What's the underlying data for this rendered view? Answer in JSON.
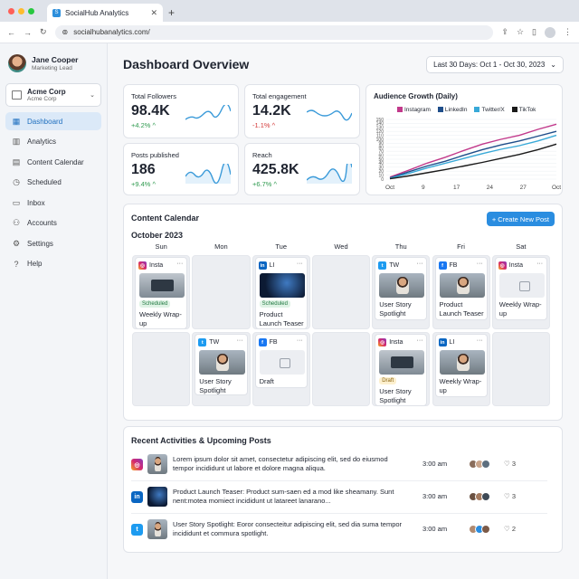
{
  "browser": {
    "tab_title": "SocialHub Analytics",
    "tab_close": "✕",
    "new_tab": "+",
    "url": "socialhubanalytics.com/",
    "traffic_colors": [
      "#ff5f57",
      "#febc2e",
      "#28c840"
    ]
  },
  "user": {
    "name": "Jane Cooper",
    "role": "Marketing Lead"
  },
  "org": {
    "name": "Acme Corp",
    "sub": "Acme Corp"
  },
  "nav": [
    {
      "label": "Dashboard",
      "icon": "grid-icon",
      "glyph": "▦",
      "active": true
    },
    {
      "label": "Analytics",
      "icon": "bar-chart-icon",
      "glyph": "▥"
    },
    {
      "label": "Content Calendar",
      "icon": "calendar-icon",
      "glyph": "▤"
    },
    {
      "label": "Scheduled",
      "icon": "clock-icon",
      "glyph": "◷"
    },
    {
      "label": "Inbox",
      "icon": "inbox-icon",
      "glyph": "▭"
    },
    {
      "label": "Accounts",
      "icon": "users-icon",
      "glyph": "⚇"
    },
    {
      "label": "Settings",
      "icon": "gear-icon",
      "glyph": "⚙"
    },
    {
      "label": "Help",
      "icon": "help-icon",
      "glyph": "?"
    }
  ],
  "header": {
    "title": "Dashboard Overview",
    "date_range": "Last 30 Days: Oct 1 - Oct 30, 2023"
  },
  "stats": {
    "followers": {
      "label": "Total Followers",
      "value": "98.4K",
      "change": "+4.2% ^"
    },
    "engagement": {
      "label": "Total engagement",
      "value": "14.2K",
      "change": "-1.1% ^"
    },
    "posts": {
      "label": "Posts published",
      "value": "186",
      "change": "+9.4% ^"
    },
    "reach": {
      "label": "Reach",
      "value": "425.8K",
      "change": "+6.7% ^"
    }
  },
  "audience": {
    "title": "Audience Growth (Daily)",
    "legend": [
      "Instagram",
      "LinkedIn",
      "Twitter/X",
      "TikTok"
    ]
  },
  "chart_data": {
    "type": "line",
    "title": "Audience Growth (Daily)",
    "x": [
      "Oct",
      "9",
      "17",
      "24",
      "27",
      "Oct"
    ],
    "ylim": [
      0,
      150
    ],
    "yticks": [
      0,
      10,
      20,
      30,
      40,
      50,
      60,
      70,
      80,
      90,
      100,
      110,
      120,
      130,
      140,
      150
    ],
    "grid": true,
    "legend_position": "top",
    "series": [
      {
        "name": "Instagram",
        "color": "#c2398b",
        "values": [
          5,
          22,
          40,
          55,
          72,
          88,
          100,
          110,
          125,
          138
        ]
      },
      {
        "name": "LinkedIn",
        "color": "#1f4e8a",
        "values": [
          3,
          18,
          33,
          45,
          60,
          74,
          86,
          96,
          108,
          120
        ]
      },
      {
        "name": "Twitter/X",
        "color": "#38a9d8",
        "values": [
          2,
          14,
          28,
          40,
          52,
          64,
          75,
          84,
          96,
          110
        ]
      },
      {
        "name": "TikTok",
        "color": "#1a1a1a",
        "values": [
          1,
          8,
          16,
          24,
          33,
          42,
          52,
          62,
          74,
          88
        ]
      }
    ]
  },
  "calendar": {
    "title": "Content Calendar",
    "button": "+ Create New Post",
    "month": "October 2023",
    "days": [
      "Sun",
      "Mon",
      "Tue",
      "Wed",
      "Thu",
      "Fri",
      "Sat"
    ],
    "posts": [
      {
        "platform": "Insta",
        "badge": "Scheduled",
        "text": "Weekly Wrap-up"
      },
      {
        "platform": "LI",
        "badge": "Scheduled",
        "text": "Product Launch Teaser"
      },
      {
        "platform": "TW",
        "text": "User Story Spotlight"
      },
      {
        "platform": "FB",
        "text": "Product Launch Teaser"
      },
      {
        "platform": "Insta",
        "text": "Weekly Wrap-up"
      },
      {
        "platform": "TW",
        "text": "User Story Spotlight"
      },
      {
        "platform": "FB",
        "text": "Draft"
      },
      {
        "platform": "Insta",
        "badge": "Draft",
        "text": "User Story Spotlight"
      },
      {
        "platform": "LI",
        "text": "Weekly Wrap-up"
      }
    ]
  },
  "activities": {
    "title": "Recent Activities & Upcoming Posts",
    "rows": [
      {
        "text": "Lorem ipsum dolor sit amet, consectetur adipiscing elit, sed do eiusmod tempor incididunt ut labore et dolore magna aliqua.",
        "time": "3:00 am",
        "likes": "3"
      },
      {
        "text": "Product Launch Teaser: Product sum-saen ed a mod like sheamany. Sunt nent:motea momiect incididunt ut latareet lanarano...",
        "time": "3:00 am",
        "likes": "3"
      },
      {
        "text": "User Story Spotlight: Eoror consecteitur adipiscing elit, sed dia suma tempor incididunt et commura spotlight.",
        "time": "3:00 am",
        "likes": "2"
      }
    ]
  }
}
